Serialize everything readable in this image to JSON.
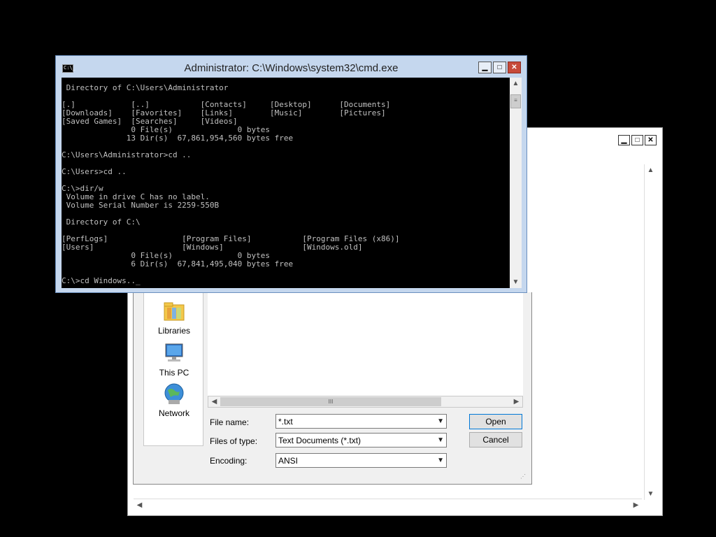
{
  "notepad": {
    "minimize_glyph": "▁",
    "maximize_glyph": "□",
    "close_glyph": "✕"
  },
  "open_dialog": {
    "places": [
      {
        "label": "Libraries",
        "icon": "libraries-icon"
      },
      {
        "label": "This PC",
        "icon": "this-pc-icon"
      },
      {
        "label": "Network",
        "icon": "network-icon"
      }
    ],
    "file_name_label": "File name:",
    "file_name_value": "*.txt",
    "file_type_label": "Files of type:",
    "file_type_value": "Text Documents (*.txt)",
    "encoding_label": "Encoding:",
    "encoding_value": "ANSI",
    "open_label": "Open",
    "cancel_label": "Cancel",
    "scroll_thumb_glyph": "III"
  },
  "cmd": {
    "title": "Administrator: C:\\Windows\\system32\\cmd.exe",
    "icon_text": "C:\\_",
    "output": " Directory of C:\\Users\\Administrator\n\n[.]            [..]           [Contacts]     [Desktop]      [Documents]\n[Downloads]    [Favorites]    [Links]        [Music]        [Pictures]\n[Saved Games]  [Searches]     [Videos]\n               0 File(s)              0 bytes\n              13 Dir(s)  67,861,954,560 bytes free\n\nC:\\Users\\Administrator>cd ..\n\nC:\\Users>cd ..\n\nC:\\>dir/w\n Volume in drive C has no label.\n Volume Serial Number is 2259-550B\n\n Directory of C:\\\n\n[PerfLogs]                [Program Files]           [Program Files (x86)]\n[Users]                   [Windows]                 [Windows.old]\n               0 File(s)              0 bytes\n               6 Dir(s)  67,841,495,040 bytes free\n\nC:\\>cd Windows.._",
    "scroll_thumb_glyph": "≡"
  },
  "colors": {
    "cmd_background": "#000000",
    "cmd_text": "#c0c0c0",
    "cmd_frame": "#c5d7ee",
    "close_button": "#c74a3a"
  }
}
